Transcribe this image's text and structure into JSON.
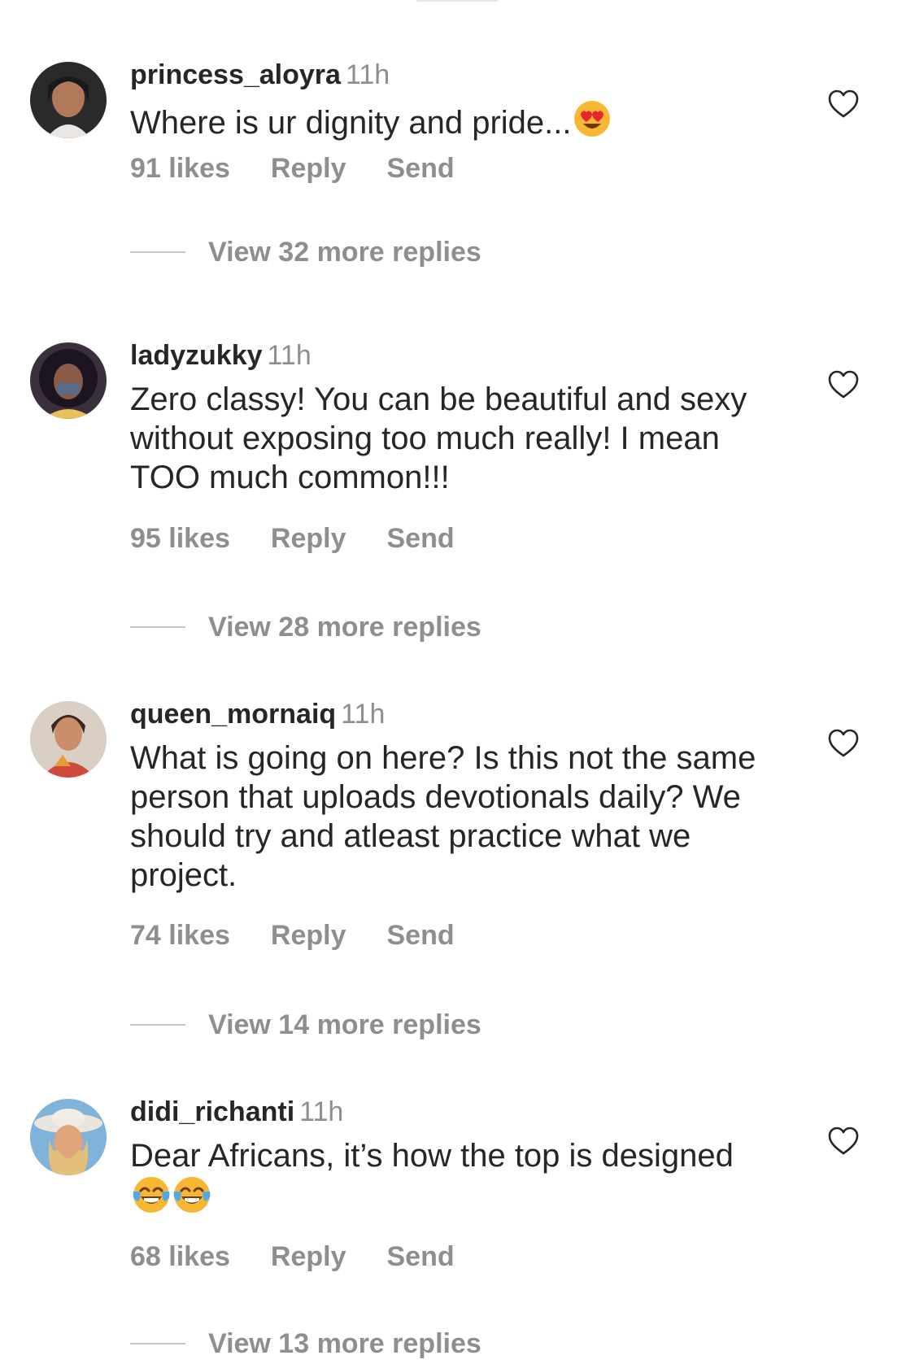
{
  "comments": [
    {
      "username": "princess_aloyra",
      "time": "11h",
      "text": "Where is ur dignity and pride...",
      "emoji": "heart-eyes-emoji",
      "likes": "91 likes",
      "reply": "Reply",
      "send": "Send",
      "view_replies": "View 32 more replies"
    },
    {
      "username": "ladyzukky",
      "time": "11h",
      "text": "Zero classy! You can be beautiful and sexy without exposing too much really! I mean TOO much common!!!",
      "likes": "95 likes",
      "reply": "Reply",
      "send": "Send",
      "view_replies": "View 28 more replies"
    },
    {
      "username": "queen_mornaiq",
      "time": "11h",
      "text": "What is going on here? Is this not the same person that uploads devotionals daily? We should try and atleast practice what we project.",
      "likes": "74 likes",
      "reply": "Reply",
      "send": "Send",
      "view_replies": "View 14 more replies"
    },
    {
      "username": "didi_richanti",
      "time": "11h",
      "text": "Dear Africans, it’s how the top is designed",
      "emoji": "laughing-tears-emoji",
      "likes": "68 likes",
      "reply": "Reply",
      "send": "Send",
      "view_replies": "View 13 more replies"
    }
  ],
  "colors": {
    "primary_text": "#262626",
    "secondary_text": "#8e8e8e",
    "divider": "#c7c7c7",
    "background": "#ffffff"
  },
  "icons": {
    "like": "heart-outline-icon"
  }
}
